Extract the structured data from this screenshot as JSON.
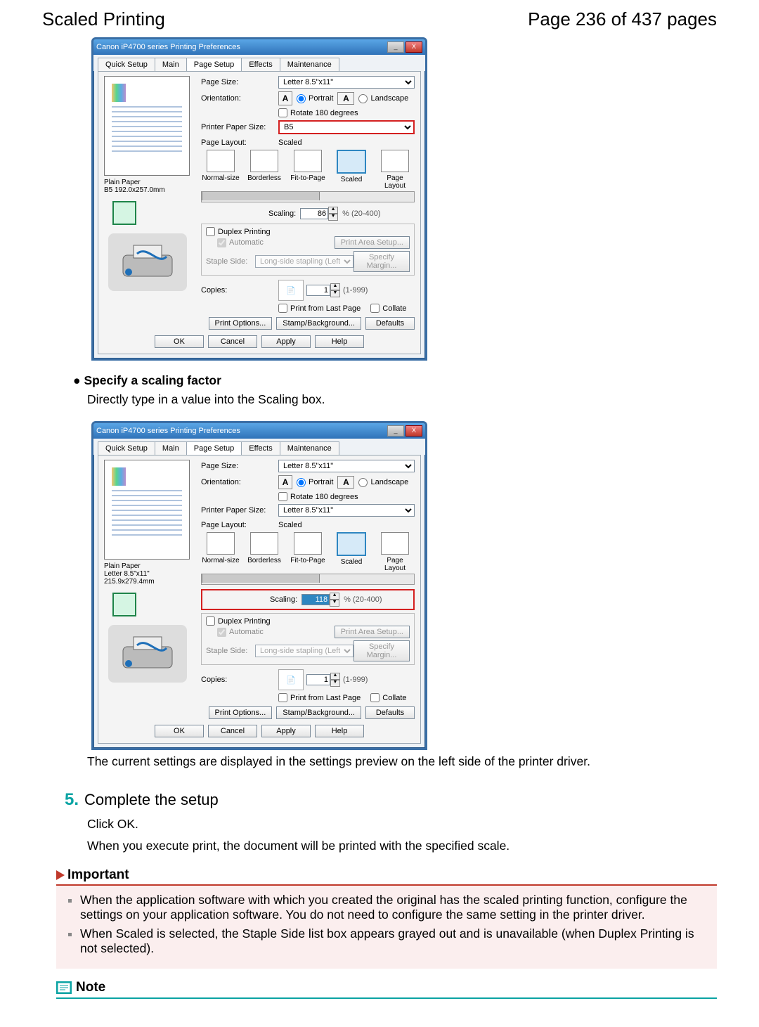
{
  "header": {
    "title": "Scaled Printing",
    "page": "Page 236 of 437 pages"
  },
  "dialog_common": {
    "window_title": "Canon iP4700 series Printing Preferences",
    "tabs": {
      "quick": "Quick Setup",
      "main": "Main",
      "page": "Page Setup",
      "effects": "Effects",
      "maint": "Maintenance"
    },
    "labels": {
      "page_size": "Page Size:",
      "orientation": "Orientation:",
      "portrait": "Portrait",
      "landscape": "Landscape",
      "rotate": "Rotate 180 degrees",
      "printer_paper": "Printer Paper Size:",
      "page_layout": "Page Layout:",
      "scaling": "Scaling:",
      "scaling_range": "% (20-400)",
      "duplex": "Duplex Printing",
      "automatic": "Automatic",
      "print_area": "Print Area Setup...",
      "staple": "Staple Side:",
      "staple_val": "Long-side stapling (Left)",
      "specify_margin": "Specify Margin...",
      "copies": "Copies:",
      "copies_range": "(1-999)",
      "print_last": "Print from Last Page",
      "collate": "Collate",
      "print_options": "Print Options...",
      "stamp": "Stamp/Background...",
      "defaults": "Defaults",
      "ok": "OK",
      "cancel": "Cancel",
      "apply": "Apply",
      "help": "Help",
      "layout_scaled": "Scaled",
      "layouts": [
        "Normal-size",
        "Borderless",
        "Fit-to-Page",
        "Scaled",
        "Page Layout"
      ]
    }
  },
  "dialog1": {
    "page_size_val": "Letter 8.5\"x11\"",
    "printer_paper_val": "B5",
    "preview_line1": "Plain Paper",
    "preview_line2": "B5 192.0x257.0mm",
    "scaling_val": "86",
    "copies_val": "1"
  },
  "dialog2": {
    "page_size_val": "Letter 8.5\"x11\"",
    "printer_paper_val": "Letter 8.5\"x11\"",
    "preview_line1": "Plain Paper",
    "preview_line2": "Letter 8.5\"x11\" 215.9x279.4mm",
    "scaling_val": "118",
    "copies_val": "1"
  },
  "body": {
    "bullet1_title": "Specify a scaling factor",
    "bullet1_text": "Directly type in a value into the Scaling box.",
    "after_dialog2": "The current settings are displayed in the settings preview on the left side of the printer driver.",
    "step5_num": "5.",
    "step5_title": "Complete the setup",
    "step5_l1": "Click OK.",
    "step5_l2": "When you execute print, the document will be printed with the specified scale.",
    "important": "Important",
    "imp_li1": "When the application software with which you created the original has the scaled printing function, configure the settings on your application software. You do not need to configure the same setting in the printer driver.",
    "imp_li2": "When Scaled is selected, the Staple Side list box appears grayed out and is unavailable (when Duplex Printing is not selected).",
    "note": "Note"
  }
}
